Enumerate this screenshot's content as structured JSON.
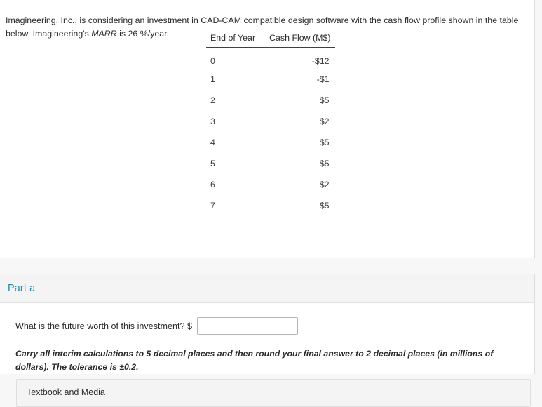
{
  "problem": {
    "text_part1": "Imagineering, Inc., is considering an investment in CAD-CAM compatible design software with the cash flow profile shown in the table below. Imagineering's ",
    "marr_emphasis": "MARR",
    "text_part2": " is 26 %/year."
  },
  "cash_flow_table": {
    "columns": [
      "End of Year",
      "Cash Flow (M$)"
    ],
    "rows": [
      {
        "year": "0",
        "cash_flow": "-$12"
      },
      {
        "year": "1",
        "cash_flow": "-$1"
      },
      {
        "year": "2",
        "cash_flow": "$5"
      },
      {
        "year": "3",
        "cash_flow": "$2"
      },
      {
        "year": "4",
        "cash_flow": "$5"
      },
      {
        "year": "5",
        "cash_flow": "$5"
      },
      {
        "year": "6",
        "cash_flow": "$2"
      },
      {
        "year": "7",
        "cash_flow": "$5"
      }
    ]
  },
  "part_a": {
    "title": "Part a",
    "question_label": "What is the future worth of this investment? $",
    "answer_value": "",
    "answer_placeholder": "",
    "tolerance_note": "Carry all interim calculations to 5 decimal places and then round your final answer to 2 decimal places (in millions of dollars). The tolerance is ±0.2."
  },
  "media_box": {
    "label": "Textbook and Media"
  },
  "colors": {
    "part_title": "#2389ab",
    "body_text": "#2b2b2b",
    "card_background": "#ffffff",
    "page_background": "#f7f7f7",
    "header_band": "#f4f4f4"
  }
}
